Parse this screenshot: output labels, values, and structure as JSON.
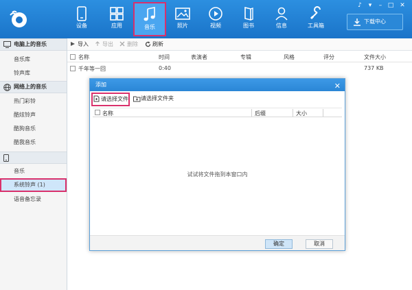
{
  "nav": {
    "items": [
      {
        "label": "设备",
        "icon": "device-icon"
      },
      {
        "label": "应用",
        "icon": "apps-icon"
      },
      {
        "label": "音乐",
        "icon": "music-icon",
        "active": true
      },
      {
        "label": "照片",
        "icon": "photo-icon"
      },
      {
        "label": "视频",
        "icon": "video-icon"
      },
      {
        "label": "图书",
        "icon": "book-icon"
      },
      {
        "label": "信息",
        "icon": "user-icon"
      },
      {
        "label": "工具箱",
        "icon": "wrench-icon"
      }
    ],
    "download_label": "下载中心",
    "window_controls": [
      "♪",
      "▾",
      "–",
      "□",
      "✕"
    ]
  },
  "sidebar": {
    "sections": [
      {
        "title": "电脑上的音乐",
        "icon": "monitor-icon",
        "items": [
          "音乐库",
          "铃声库"
        ]
      },
      {
        "title": "网络上的音乐",
        "icon": "globe-icon",
        "items": [
          "热门彩铃",
          "酷炫铃声",
          "酷狗音乐",
          "酷我音乐"
        ]
      },
      {
        "title": "",
        "icon": "phone-icon",
        "items": [
          "音乐",
          "系统铃声 (1)",
          "语音备忘录"
        ]
      }
    ]
  },
  "toolbar": {
    "import": "导入",
    "export": "导出",
    "delete": "删除",
    "refresh": "刷新"
  },
  "table": {
    "columns": [
      "名称",
      "时间",
      "表演者",
      "专辑",
      "风格",
      "评分",
      "文件大小"
    ],
    "rows": [
      {
        "name": "千年等一回",
        "time": "0:40",
        "size": "737 KB"
      }
    ]
  },
  "modal": {
    "title": "添加",
    "close": "✕",
    "select_file": "请选择文件",
    "select_folder": "请选择文件夹",
    "columns": [
      "名称",
      "后缀",
      "大小"
    ],
    "drop_hint": "试试将文件拖到本窗口内",
    "ok": "确定",
    "cancel": "取消"
  },
  "colors": {
    "accent": "#1a74c9",
    "highlight": "#d9306b"
  }
}
